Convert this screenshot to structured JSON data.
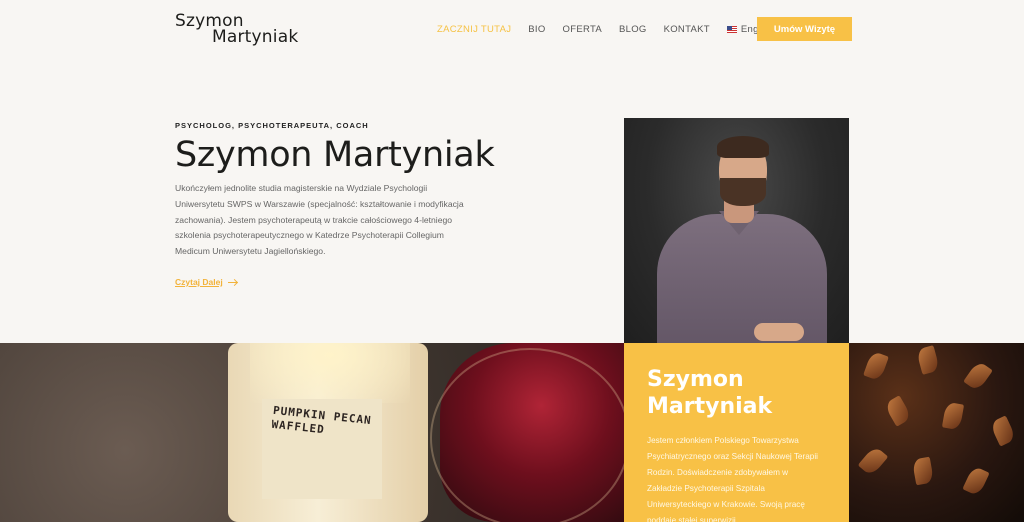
{
  "logo": {
    "line1": "Szymon",
    "line2": "Martyniak"
  },
  "nav": {
    "items": [
      {
        "label": "ZACZNIJ TUTAJ",
        "active": true
      },
      {
        "label": "BIO"
      },
      {
        "label": "OFERTA"
      },
      {
        "label": "BLOG"
      },
      {
        "label": "KONTAKT"
      }
    ],
    "language": "English",
    "cta": "Umów Wizytę"
  },
  "hero": {
    "eyebrow": "PSYCHOLOG, PSYCHOTERAPEUTA, COACH",
    "title": "Szymon Martyniak",
    "text": "Ukończyłem jednolite studia magisterskie na Wydziale Psychologii Uniwersytetu SWPS w Warszawie (specjalność: kształtowanie i modyfikacja zachowania). Jestem psychoterapeutą w trakcie całościowego 4-letniego szkolenia psychoterapeutycznego w Katedrze Psychoterapii Collegium Medicum Uniwersytetu Jagiellońskiego.",
    "read_more": "Czytaj Dalej"
  },
  "candle_label": "PUMPKIN PECAN WAFFLED",
  "info": {
    "title_line1": "Szymon",
    "title_line2": "Martyniak",
    "text": "Jestem członkiem Polskiego Towarzystwa Psychiatrycznego oraz Sekcji Naukowej Terapii Rodzin. Doświadczenie zdobywałem w Zakładzie Psychoterapii Szpitala Uniwersyteckiego w Krakowie. Swoją pracę poddaję stałej superwizji."
  },
  "colors": {
    "accent": "#f8c146",
    "background": "#f8f6f3",
    "text": "#1d1d1b"
  },
  "icons": {
    "arrow": "arrow-right-icon",
    "flag": "us-flag-icon"
  }
}
